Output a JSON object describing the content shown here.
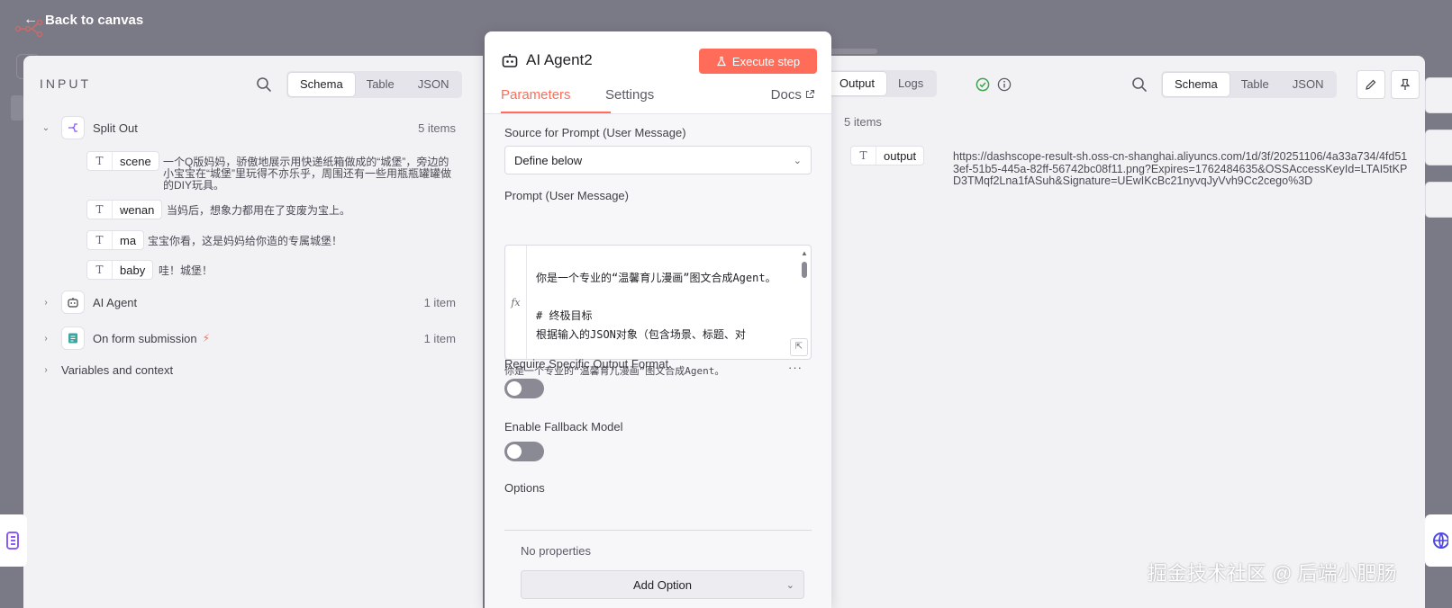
{
  "topbar": {
    "back_label": "Back to canvas"
  },
  "input": {
    "title": "INPUT",
    "tabs": [
      "Schema",
      "Table",
      "JSON"
    ],
    "nodes": [
      {
        "name": "Split Out",
        "count": "5 items",
        "fields": [
          {
            "key": "scene",
            "value": "一个Q版妈妈，骄傲地展示用快递纸箱做成的“城堡”，旁边的小宝宝在“城堡”里玩得不亦乐乎，周围还有一些用瓶瓶罐罐做的DIY玩具。"
          },
          {
            "key": "wenan",
            "value": "当妈后，想象力都用在了变废为宝上。"
          },
          {
            "key": "ma",
            "value": "宝宝你看，这是妈妈给你造的专属城堡！"
          },
          {
            "key": "baby",
            "value": "哇！城堡！"
          }
        ]
      },
      {
        "name": "AI Agent",
        "count": "1 item"
      },
      {
        "name": "On form submission",
        "count": "1 item"
      }
    ],
    "variables_label": "Variables and context"
  },
  "node": {
    "title": "AI Agent2",
    "execute_label": "Execute step",
    "tabs": {
      "parameters": "Parameters",
      "settings": "Settings",
      "docs": "Docs"
    },
    "source_label": "Source for Prompt (User Message)",
    "source_value": "Define below",
    "prompt_label": "Prompt (User Message)",
    "prompt_text": "你是一个专业的“温馨育儿漫画”图文合成Agent。\n\n# 终极目标\n根据输入的JSON对象（包含场景、标题、对",
    "prompt_preview": "你是一个专业的“温馨育儿漫画”图文合成Agent。",
    "require_format_label": "Require Specific Output Format",
    "fallback_label": "Enable Fallback Model",
    "options_label": "Options",
    "no_properties": "No properties",
    "add_option": "Add Option"
  },
  "output": {
    "tabs": [
      "Output",
      "Logs"
    ],
    "view_tabs": [
      "Schema",
      "Table",
      "JSON"
    ],
    "items_count": "5 items",
    "field_key": "output",
    "field_value": "https://dashscope-result-sh.oss-cn-shanghai.aliyuncs.com/1d/3f/20251106/4a33a734/4fd513ef-51b5-445a-82ff-56742bc08f11.png?Expires=1762484635&OSSAccessKeyId=LTAI5tKPD3TMqf2Lna1fASuh&Signature=UEwIKcBc21nyvqJyVvh9Cc2cego%3D"
  },
  "watermark": "掘金技术社区 @ 后端小肥肠",
  "colors": {
    "accent": "#ff6d5a",
    "success": "#3fa34d"
  }
}
